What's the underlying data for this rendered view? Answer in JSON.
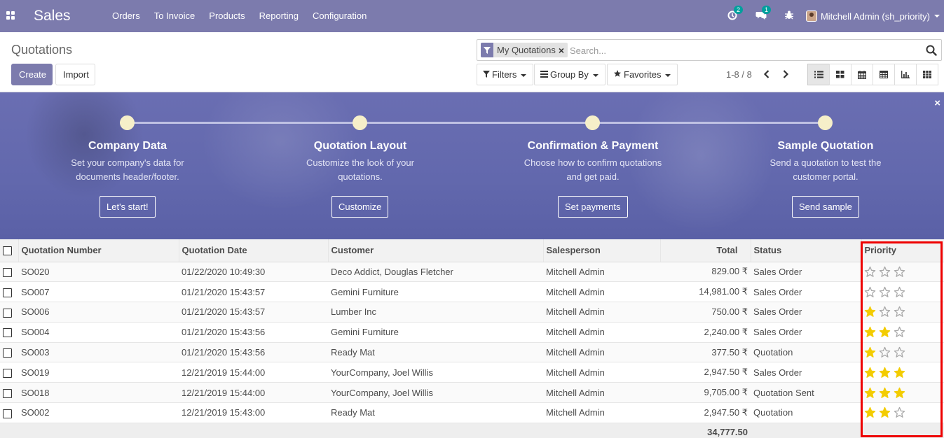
{
  "navbar": {
    "app_name": "Sales",
    "menu": [
      "Orders",
      "To Invoice",
      "Products",
      "Reporting",
      "Configuration"
    ],
    "activity_count": "2",
    "messages_count": "1",
    "user_name": "Mitchell Admin (sh_priority)"
  },
  "control_panel": {
    "breadcrumb": "Quotations",
    "create_label": "Create",
    "import_label": "Import",
    "facet_label": "My Quotations",
    "search_placeholder": "Search...",
    "filters_label": "Filters",
    "groupby_label": "Group By",
    "favorites_label": "Favorites",
    "pager": "1-8 / 8",
    "views": [
      "list",
      "kanban",
      "calendar",
      "pivot",
      "graph",
      "activity"
    ]
  },
  "onboarding": {
    "steps": [
      {
        "title": "Company Data",
        "desc": "Set your company's data for documents header/footer.",
        "button": "Let's start!"
      },
      {
        "title": "Quotation Layout",
        "desc": "Customize the look of your quotations.",
        "button": "Customize"
      },
      {
        "title": "Confirmation & Payment",
        "desc": "Choose how to confirm quotations and get paid.",
        "button": "Set payments"
      },
      {
        "title": "Sample Quotation",
        "desc": "Send a quotation to test the customer portal.",
        "button": "Send sample"
      }
    ]
  },
  "table": {
    "columns": [
      "Quotation Number",
      "Quotation Date",
      "Customer",
      "Salesperson",
      "Total",
      "Status",
      "Priority"
    ],
    "rows": [
      {
        "number": "SO020",
        "date": "01/22/2020 10:49:30",
        "customer": "Deco Addict, Douglas Fletcher",
        "salesperson": "Mitchell Admin",
        "total": "829.00 ₹",
        "status": "Sales Order",
        "priority": 0
      },
      {
        "number": "SO007",
        "date": "01/21/2020 15:43:57",
        "customer": "Gemini Furniture",
        "salesperson": "Mitchell Admin",
        "total": "14,981.00 ₹",
        "status": "Sales Order",
        "priority": 0
      },
      {
        "number": "SO006",
        "date": "01/21/2020 15:43:57",
        "customer": "Lumber Inc",
        "salesperson": "Mitchell Admin",
        "total": "750.00 ₹",
        "status": "Sales Order",
        "priority": 1
      },
      {
        "number": "SO004",
        "date": "01/21/2020 15:43:56",
        "customer": "Gemini Furniture",
        "salesperson": "Mitchell Admin",
        "total": "2,240.00 ₹",
        "status": "Sales Order",
        "priority": 2
      },
      {
        "number": "SO003",
        "date": "01/21/2020 15:43:56",
        "customer": "Ready Mat",
        "salesperson": "Mitchell Admin",
        "total": "377.50 ₹",
        "status": "Quotation",
        "priority": 1
      },
      {
        "number": "SO019",
        "date": "12/21/2019 15:44:00",
        "customer": "YourCompany, Joel Willis",
        "salesperson": "Mitchell Admin",
        "total": "2,947.50 ₹",
        "status": "Sales Order",
        "priority": 3
      },
      {
        "number": "SO018",
        "date": "12/21/2019 15:44:00",
        "customer": "YourCompany, Joel Willis",
        "salesperson": "Mitchell Admin",
        "total": "9,705.00 ₹",
        "status": "Quotation Sent",
        "priority": 3
      },
      {
        "number": "SO002",
        "date": "12/21/2019 15:43:00",
        "customer": "Ready Mat",
        "salesperson": "Mitchell Admin",
        "total": "2,947.50 ₹",
        "status": "Quotation",
        "priority": 2
      }
    ],
    "sum_total": "34,777.50"
  },
  "colors": {
    "brand": "#7c7bad",
    "star_filled": "#f3cc00",
    "star_empty": "#a8a8a8",
    "highlight": "#ee0000"
  }
}
